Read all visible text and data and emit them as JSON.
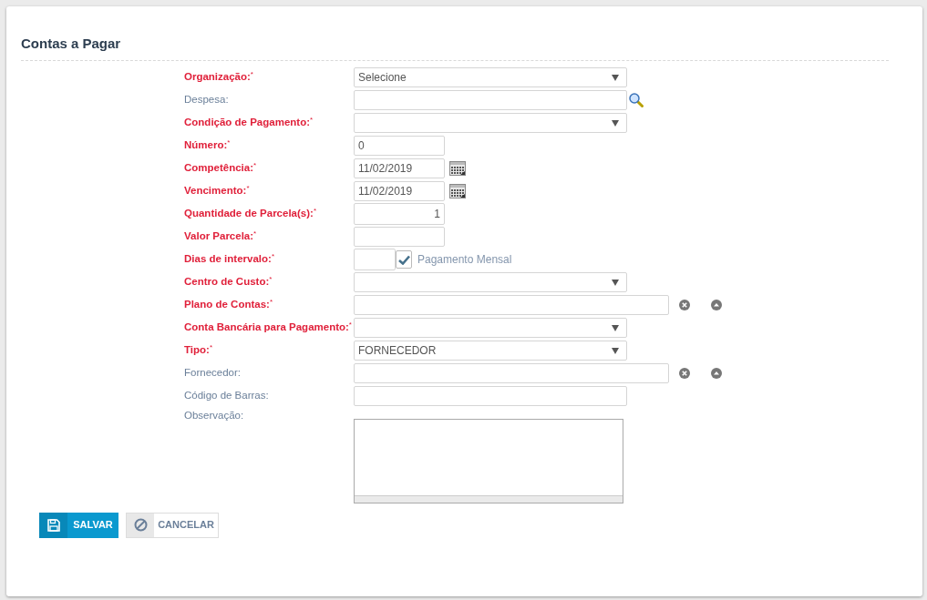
{
  "title": "Contas a Pagar",
  "fields": [
    {
      "label": "Organização:",
      "required": true,
      "mark": "*",
      "kind": "select",
      "value": "Selecione"
    },
    {
      "label": "Despesa:",
      "required": false,
      "kind": "lookup"
    },
    {
      "label": "Condição de Pagamento:",
      "required": true,
      "mark": "*",
      "kind": "select"
    },
    {
      "label": "Número:",
      "required": true,
      "mark": "*",
      "kind": "short",
      "value": "0"
    },
    {
      "label": "Competência:",
      "required": true,
      "mark": "*",
      "kind": "date",
      "value": "11/02/2019"
    },
    {
      "label": "Vencimento:",
      "required": true,
      "mark": "*",
      "kind": "date",
      "value": "11/02/2019"
    },
    {
      "label": "Quantidade de Parcela(s):",
      "required": true,
      "mark": "*",
      "kind": "number",
      "value": "1"
    },
    {
      "label": "Valor Parcela:",
      "required": true,
      "mark": "*",
      "kind": "short"
    },
    {
      "label": "Dias de intervalo:",
      "required": true,
      "mark": "*",
      "kind": "interval",
      "checkbox": {
        "label": "Pagamento Mensal",
        "checked": true
      }
    },
    {
      "label": "Centro de Custo:",
      "required": true,
      "mark": "*",
      "kind": "select"
    },
    {
      "label": "Plano de Contas:",
      "required": true,
      "mark": "*",
      "kind": "picker"
    },
    {
      "label": "Conta Bancária para Pagamento:",
      "required": true,
      "mark": "*",
      "kind": "select"
    },
    {
      "label": "Tipo:",
      "required": true,
      "mark": "*",
      "kind": "select",
      "value": "FORNECEDOR"
    },
    {
      "label": "Fornecedor:",
      "required": false,
      "kind": "picker"
    },
    {
      "label": "Código de Barras:",
      "required": false,
      "kind": "text"
    },
    {
      "label": "Observação:",
      "required": false,
      "kind": "textarea"
    }
  ],
  "buttons": [
    {
      "label": "SALVAR",
      "kind": "primary"
    },
    {
      "label": "CANCELAR",
      "kind": "secondary"
    }
  ]
}
